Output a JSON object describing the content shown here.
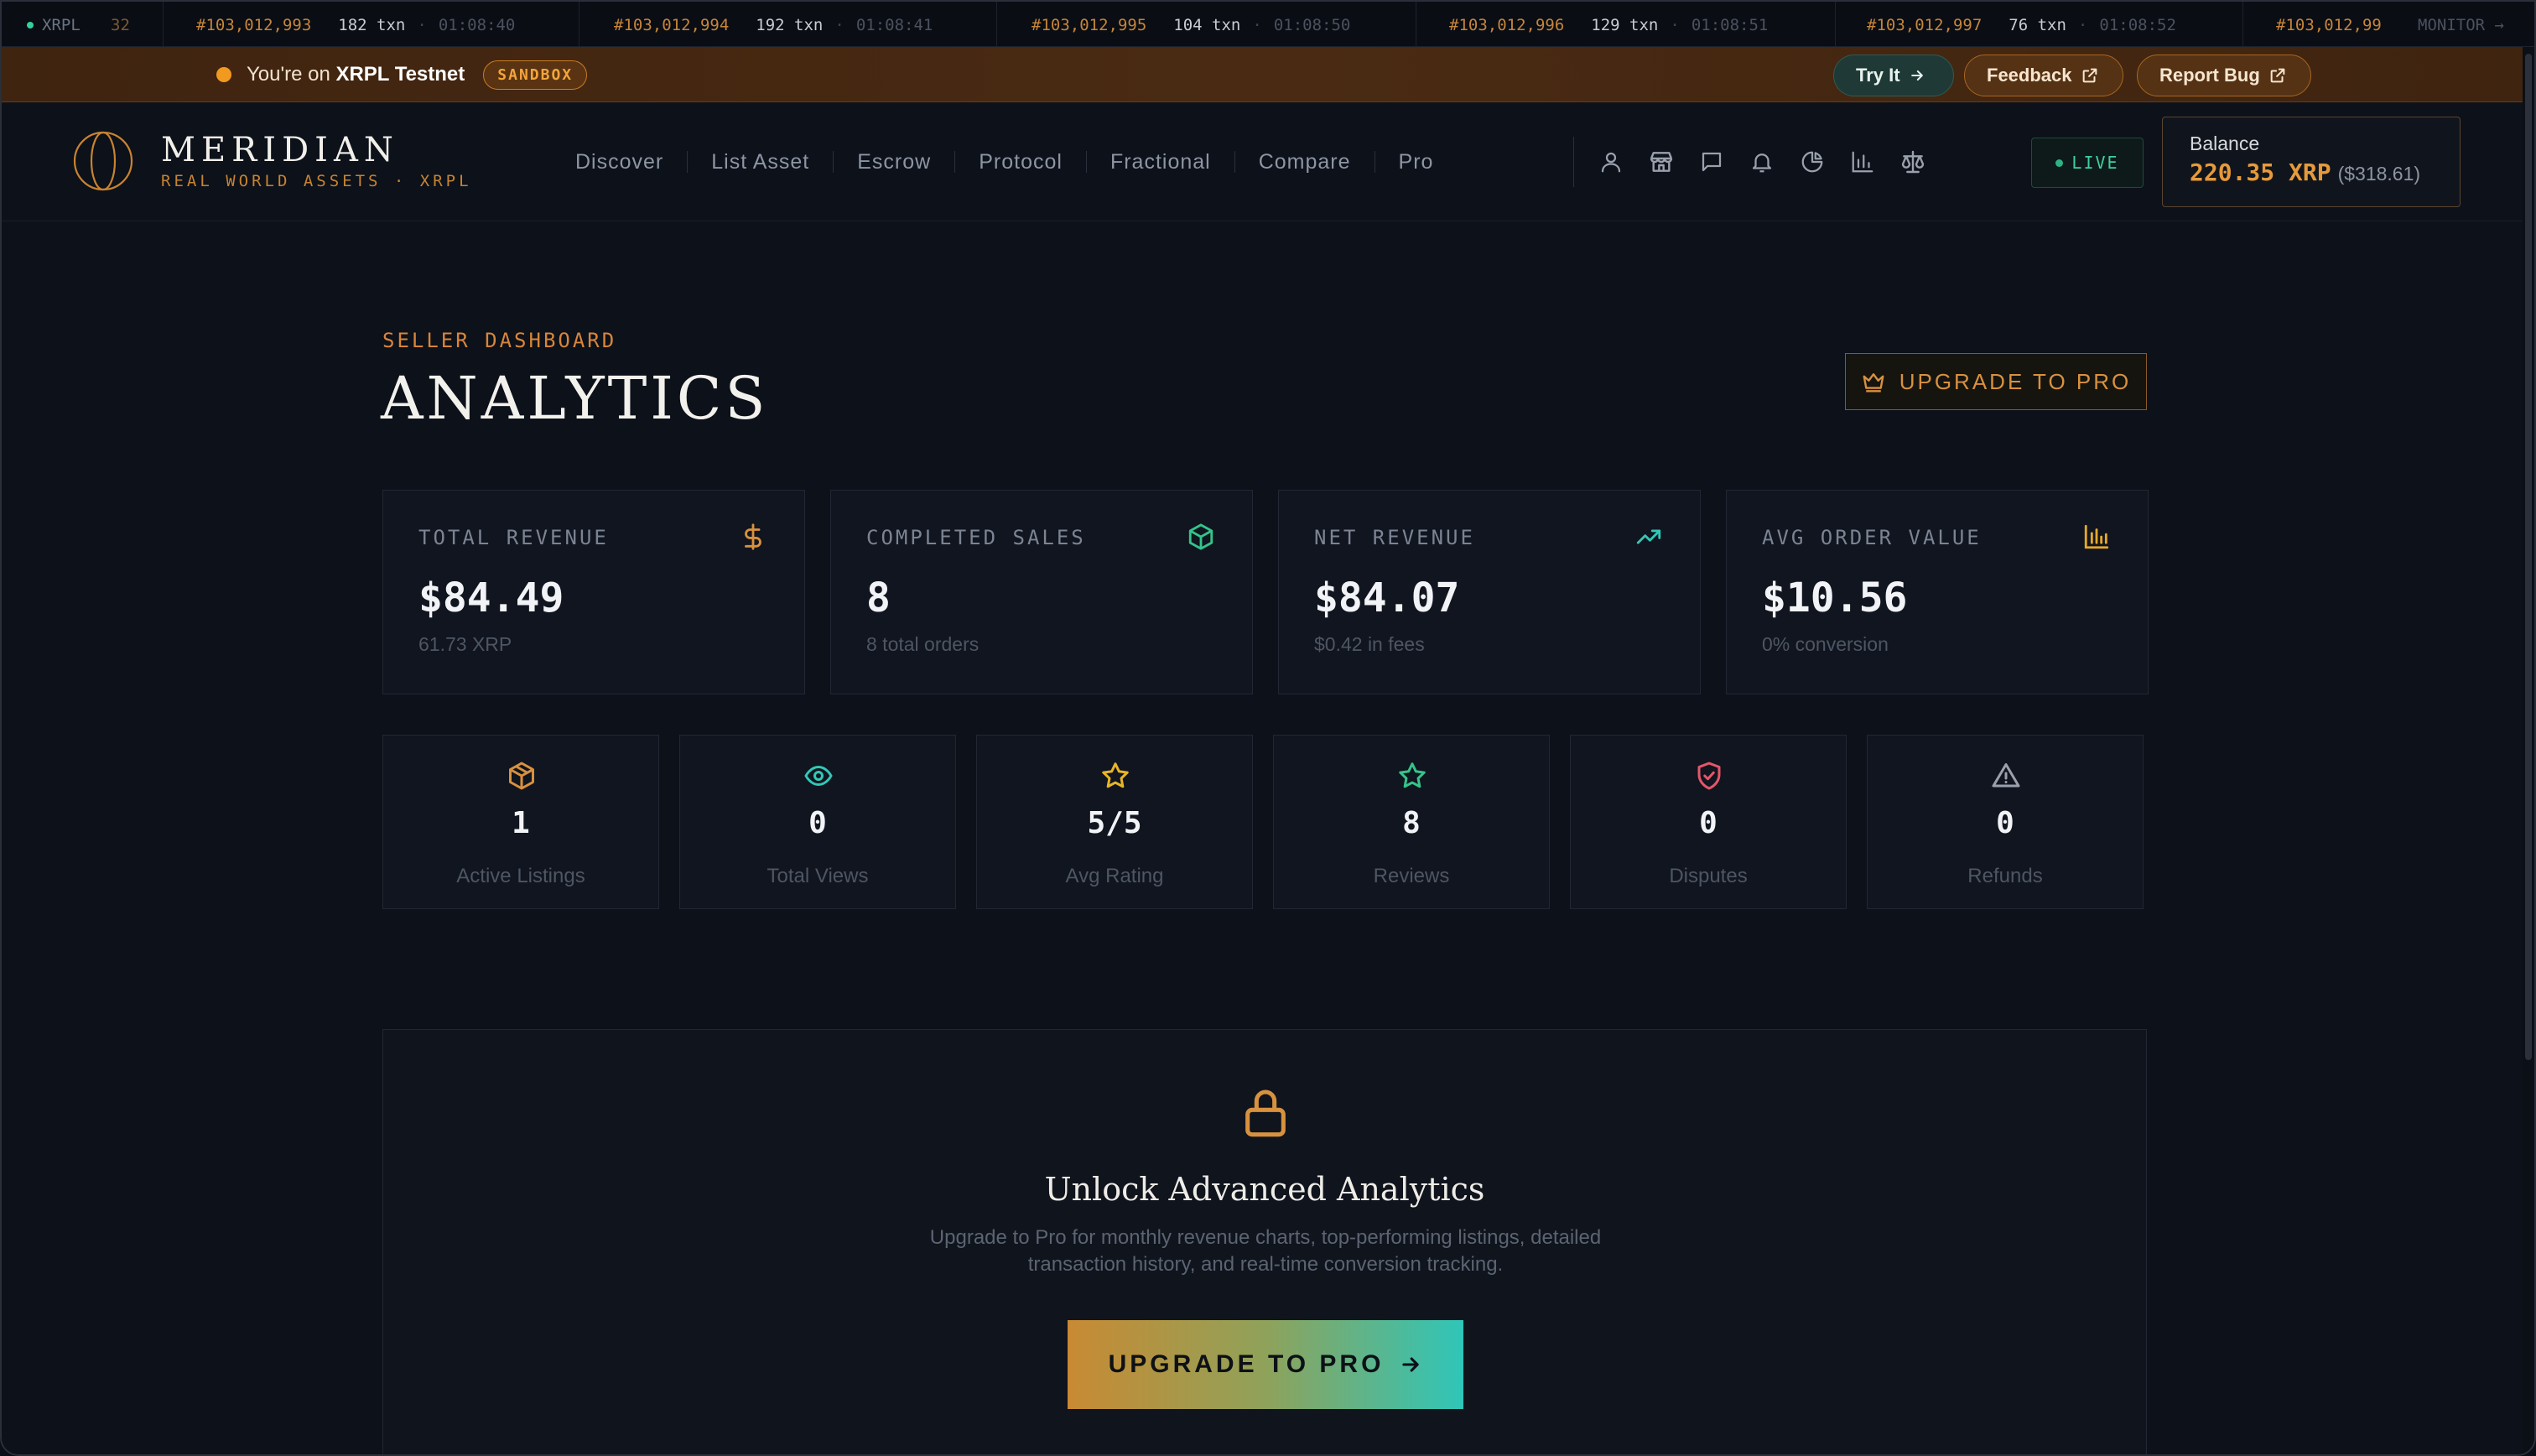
{
  "ticker": {
    "network": "XRPL",
    "cut_fragment": "32",
    "items": [
      {
        "block": "#103,012,993",
        "txn": "182 txn",
        "time": "01:08:40"
      },
      {
        "block": "#103,012,994",
        "txn": "192 txn",
        "time": "01:08:41"
      },
      {
        "block": "#103,012,995",
        "txn": "104 txn",
        "time": "01:08:50"
      },
      {
        "block": "#103,012,996",
        "txn": "129 txn",
        "time": "01:08:51"
      },
      {
        "block": "#103,012,997",
        "txn": "76 txn",
        "time": "01:08:52"
      },
      {
        "block": "#103,012,99",
        "txn": "",
        "time": ""
      }
    ],
    "monitor_label": "MONITOR →"
  },
  "banner": {
    "prefix": "You're on ",
    "network": "XRPL Testnet",
    "badge": "SANDBOX",
    "try_label": "Try It",
    "feedback_label": "Feedback",
    "report_label": "Report Bug"
  },
  "header": {
    "brand_name": "MERIDIAN",
    "brand_sub": "REAL WORLD ASSETS · XRPL",
    "nav": [
      "Discover",
      "List Asset",
      "Escrow",
      "Protocol",
      "Fractional",
      "Compare",
      "Pro"
    ],
    "icons": [
      "user-icon",
      "store-icon",
      "message-icon",
      "bell-icon",
      "pie-chart-icon",
      "bar-chart-icon",
      "scale-icon"
    ],
    "live_label": "LIVE",
    "balance_label": "Balance",
    "balance_value": "220.35 XRP",
    "balance_usd": "($318.61)"
  },
  "page": {
    "kicker": "SELLER DASHBOARD",
    "title": "ANALYTICS",
    "upgrade_label": "UPGRADE TO PRO"
  },
  "stats": [
    {
      "label": "TOTAL REVENUE",
      "value": "$84.49",
      "sub": "61.73 XRP",
      "icon": "dollar-icon",
      "color": "#d8913e"
    },
    {
      "label": "COMPLETED SALES",
      "value": "8",
      "sub": "8 total orders",
      "icon": "package-icon",
      "color": "#35c48a"
    },
    {
      "label": "NET REVENUE",
      "value": "$84.07",
      "sub": "$0.42 in fees",
      "icon": "trending-up-icon",
      "color": "#33c7b6"
    },
    {
      "label": "AVG ORDER VALUE",
      "value": "$10.56",
      "sub": "0% conversion",
      "icon": "bar-chart-icon",
      "color": "#e7a92a"
    }
  ],
  "mini_stats": [
    {
      "value": "1",
      "label": "Active Listings",
      "icon": "box-icon",
      "color": "#d8913e"
    },
    {
      "value": "0",
      "label": "Total Views",
      "icon": "eye-icon",
      "color": "#33c7b6"
    },
    {
      "value": "5/5",
      "label": "Avg Rating",
      "icon": "star-icon",
      "color": "#e7b52a"
    },
    {
      "value": "8",
      "label": "Reviews",
      "icon": "star-outline-icon",
      "color": "#35c48a"
    },
    {
      "value": "0",
      "label": "Disputes",
      "icon": "shield-check-icon",
      "color": "#e5566a"
    },
    {
      "value": "0",
      "label": "Refunds",
      "icon": "warning-icon",
      "color": "#9aa1ad"
    }
  ],
  "unlock": {
    "title": "Unlock Advanced Analytics",
    "description": "Upgrade to Pro for monthly revenue charts, top-performing listings, detailed transaction history, and real-time conversion tracking.",
    "button_label": "UPGRADE TO PRO"
  }
}
